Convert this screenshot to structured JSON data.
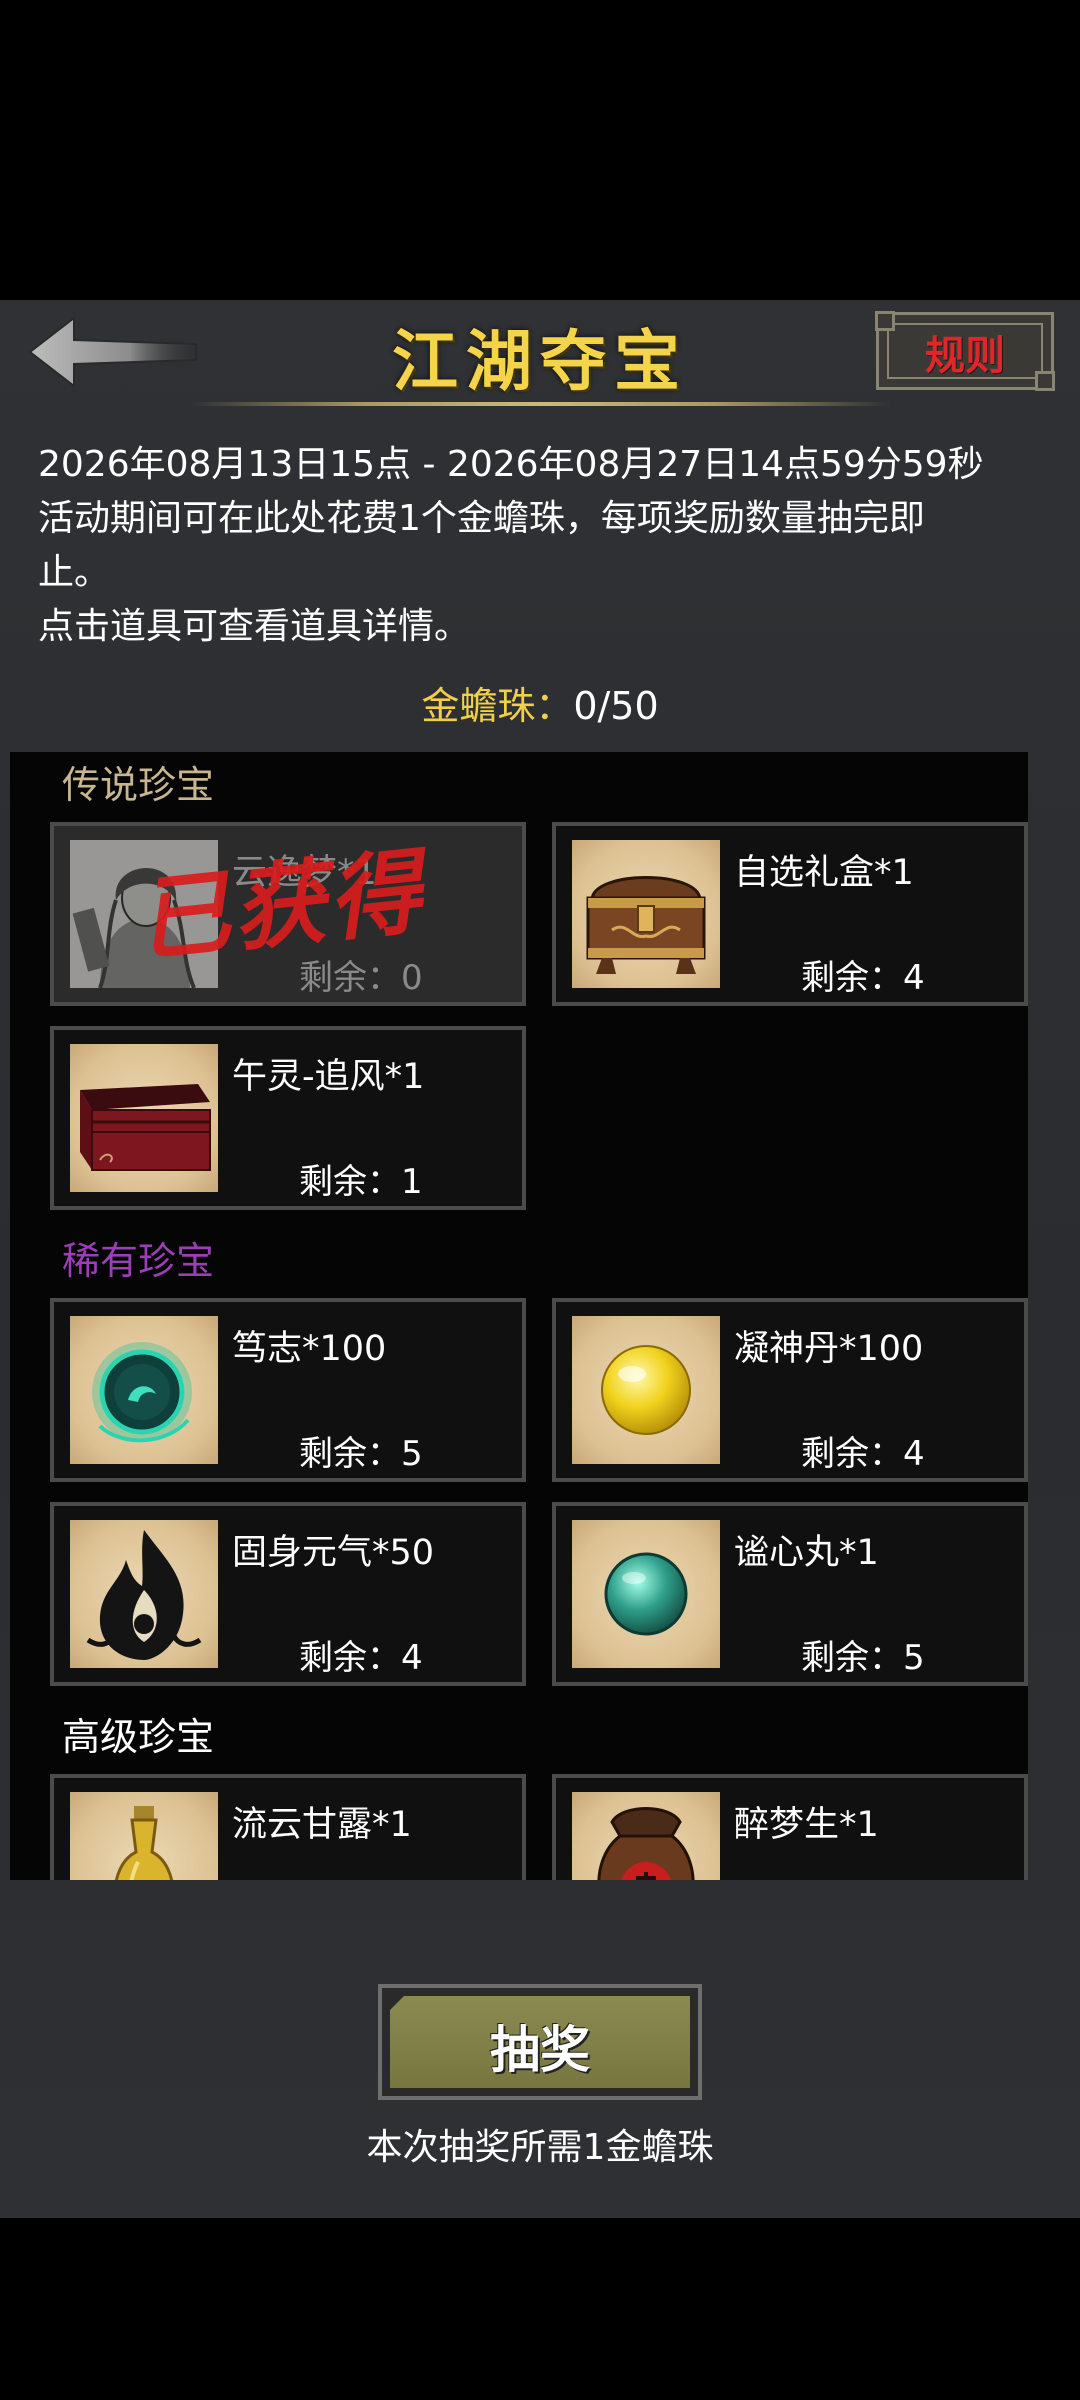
{
  "header": {
    "title": "江湖夺宝",
    "rules_label": "规则",
    "back_icon": "back-arrow-icon"
  },
  "description": {
    "period": "2026年08月13日15点 - 2026年08月27日14点59分59秒",
    "line1": "活动期间可在此处花费1个金蟾珠，每项奖励数量抽完即",
    "line2": "止。",
    "line3": "点击道具可查看道具详情。"
  },
  "currency": {
    "label": "金蟾珠：",
    "value": "0/50"
  },
  "sections": [
    {
      "title": "传说珍宝",
      "color": "#c9b690",
      "items": [
        {
          "name": "云逸梦*1",
          "remain": "剩余：0",
          "icon": "portrait-icon",
          "obtained": true,
          "stamp": "已获得"
        },
        {
          "name": "自选礼盒*1",
          "remain": "剩余：4",
          "icon": "treasure-chest-icon"
        },
        {
          "name": "午灵-追风*1",
          "remain": "剩余：1",
          "icon": "red-box-icon"
        }
      ]
    },
    {
      "title": "稀有珍宝",
      "color": "#9a3fb5",
      "items": [
        {
          "name": "笃志*100",
          "remain": "剩余：5",
          "icon": "jade-orb-icon"
        },
        {
          "name": "凝神丹*100",
          "remain": "剩余：4",
          "icon": "gold-pill-icon"
        },
        {
          "name": "固身元气*50",
          "remain": "剩余：4",
          "icon": "black-flame-icon"
        },
        {
          "name": "谧心丸*1",
          "remain": "剩余：5",
          "icon": "teal-pill-icon"
        }
      ]
    },
    {
      "title": "高级珍宝",
      "color": "#ffffff",
      "items": [
        {
          "name": "流云甘露*1",
          "icon": "gourd-bottle-icon"
        },
        {
          "name": "醉梦生*1",
          "icon": "wine-jar-icon"
        }
      ]
    }
  ],
  "draw": {
    "button_label": "抽奖",
    "note": "本次抽奖所需1金蟾珠"
  }
}
